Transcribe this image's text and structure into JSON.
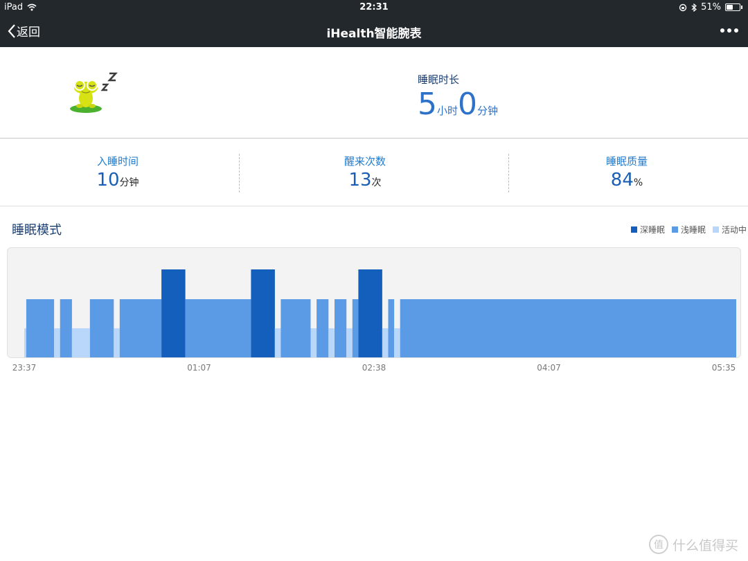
{
  "status_bar": {
    "device": "iPad",
    "time": "22:31",
    "battery": "51%",
    "battery_level": 0.51
  },
  "nav": {
    "back_label": "返回",
    "title": "iHealth智能腕表"
  },
  "summary": {
    "label": "睡眠时长",
    "hours": "5",
    "hours_unit": "小时",
    "minutes": "0",
    "minutes_unit": "分钟"
  },
  "stats": [
    {
      "label": "入睡时间",
      "value": "10",
      "unit": "分钟"
    },
    {
      "label": "醒来次数",
      "value": "13",
      "unit": "次"
    },
    {
      "label": "睡眠质量",
      "value": "84",
      "unit": "%"
    }
  ],
  "pattern": {
    "title": "睡眠模式"
  },
  "colors": {
    "deep": "#155fbc",
    "light": "#5b9be6",
    "active": "#b9d6fb"
  },
  "chart_data": {
    "type": "bar",
    "x_start": "23:37",
    "x_end": "05:35",
    "xticks": [
      "23:37",
      "01:07",
      "02:38",
      "04:07",
      "05:35"
    ],
    "legend": [
      "深睡眠",
      "浅睡眠",
      "活动中"
    ],
    "levels": {
      "活动中": 1,
      "浅睡眠": 2,
      "深睡眠": 3
    },
    "segments": [
      {
        "start": "23:37",
        "end": "23:52",
        "stage": "活动中"
      },
      {
        "start": "23:38",
        "end": "23:52",
        "stage": "浅睡眠"
      },
      {
        "start": "23:52",
        "end": "23:55",
        "stage": "活动中"
      },
      {
        "start": "23:55",
        "end": "24:01",
        "stage": "浅睡眠"
      },
      {
        "start": "24:01",
        "end": "24:10",
        "stage": "活动中"
      },
      {
        "start": "24:10",
        "end": "24:22",
        "stage": "浅睡眠"
      },
      {
        "start": "24:22",
        "end": "24:25",
        "stage": "活动中"
      },
      {
        "start": "24:25",
        "end": "24:46",
        "stage": "浅睡眠"
      },
      {
        "start": "24:46",
        "end": "24:58",
        "stage": "深睡眠"
      },
      {
        "start": "24:58",
        "end": "25:31",
        "stage": "浅睡眠"
      },
      {
        "start": "25:31",
        "end": "25:43",
        "stage": "深睡眠"
      },
      {
        "start": "25:43",
        "end": "25:46",
        "stage": "活动中"
      },
      {
        "start": "25:46",
        "end": "26:01",
        "stage": "浅睡眠"
      },
      {
        "start": "26:01",
        "end": "26:04",
        "stage": "活动中"
      },
      {
        "start": "26:04",
        "end": "26:10",
        "stage": "浅睡眠"
      },
      {
        "start": "26:10",
        "end": "26:13",
        "stage": "活动中"
      },
      {
        "start": "26:13",
        "end": "26:19",
        "stage": "浅睡眠"
      },
      {
        "start": "26:19",
        "end": "26:22",
        "stage": "活动中"
      },
      {
        "start": "26:22",
        "end": "26:25",
        "stage": "浅睡眠"
      },
      {
        "start": "26:25",
        "end": "26:37",
        "stage": "深睡眠"
      },
      {
        "start": "26:37",
        "end": "26:40",
        "stage": "活动中"
      },
      {
        "start": "26:40",
        "end": "26:43",
        "stage": "浅睡眠"
      },
      {
        "start": "26:43",
        "end": "26:46",
        "stage": "活动中"
      },
      {
        "start": "26:46",
        "end": "29:35",
        "stage": "浅睡眠"
      }
    ]
  }
}
